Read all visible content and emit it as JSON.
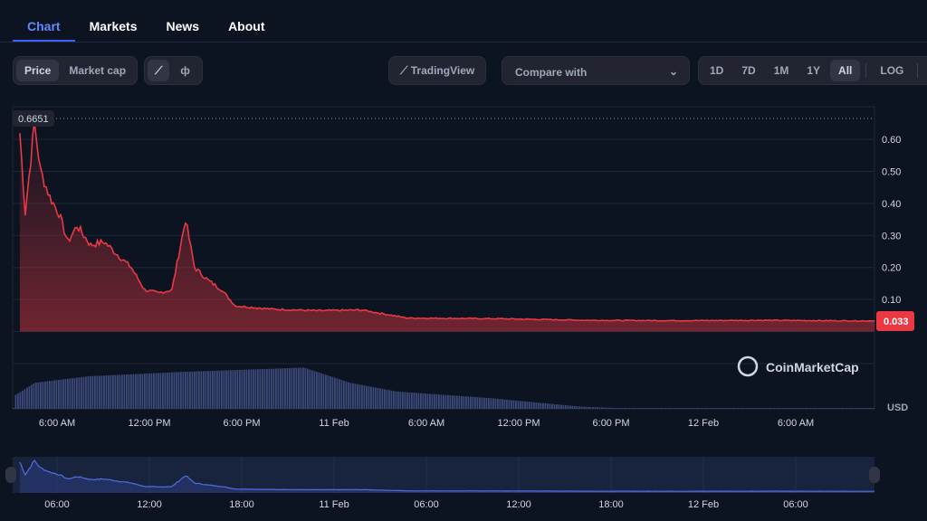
{
  "tabs": [
    {
      "label": "Chart",
      "active": true
    },
    {
      "label": "Markets"
    },
    {
      "label": "News"
    },
    {
      "label": "About"
    }
  ],
  "toolbar": {
    "price": "Price",
    "market_cap": "Market cap",
    "line_icon": "line-chart-icon",
    "candle_icon": "candlestick-icon",
    "tradingview": "TradingView",
    "compare": "Compare with",
    "ranges": [
      "1D",
      "7D",
      "1M",
      "1Y",
      "All"
    ],
    "selected_range": "All",
    "log": "LOG",
    "more": "···"
  },
  "watermark": "CoinMarketCap",
  "colors": {
    "line": "#ea3943",
    "accent": "#3861fb",
    "volume": "#3b4a7a",
    "background": "#0d1421"
  },
  "chart_data": {
    "type": "line",
    "currency_label": "USD",
    "high_label": "0.6651",
    "last_price_label": "0.033",
    "ylim": [
      0,
      0.67
    ],
    "yticks": [
      "0.10",
      "0.20",
      "0.30",
      "0.40",
      "0.50",
      "0.60"
    ],
    "xticks": [
      "6:00 AM",
      "12:00 PM",
      "6:00 PM",
      "11 Feb",
      "6:00 AM",
      "12:00 PM",
      "6:00 PM",
      "12 Feb",
      "6:00 AM"
    ],
    "grid": true,
    "price": [
      [
        "10 Feb 03:35",
        0.62
      ],
      [
        "10 Feb 03:56",
        0.37
      ],
      [
        "10 Feb 04:32",
        0.65
      ],
      [
        "10 Feb 04:56",
        0.5
      ],
      [
        "10 Feb 05:32",
        0.42
      ],
      [
        "10 Feb 06:07",
        0.37
      ],
      [
        "10 Feb 06:42",
        0.28
      ],
      [
        "10 Feb 07:18",
        0.33
      ],
      [
        "10 Feb 08:11",
        0.27
      ],
      [
        "10 Feb 09:04",
        0.28
      ],
      [
        "10 Feb 09:56",
        0.24
      ],
      [
        "10 Feb 10:49",
        0.2
      ],
      [
        "10 Feb 11:42",
        0.13
      ],
      [
        "10 Feb 12:35",
        0.12
      ],
      [
        "10 Feb 13:28",
        0.13
      ],
      [
        "10 Feb 14:21",
        0.35
      ],
      [
        "10 Feb 14:56",
        0.2
      ],
      [
        "10 Feb 15:49",
        0.16
      ],
      [
        "10 Feb 16:42",
        0.13
      ],
      [
        "10 Feb 17:35",
        0.08
      ],
      [
        "10 Feb 19:56",
        0.07
      ],
      [
        "10 Feb 22:53",
        0.065
      ],
      [
        "11 Feb 01:49",
        0.067
      ],
      [
        "11 Feb 04:46",
        0.042
      ],
      [
        "11 Feb 10:38",
        0.04
      ],
      [
        "11 Feb 16:32",
        0.035
      ],
      [
        "11 Feb 22:25",
        0.034
      ],
      [
        "12 Feb 04:00",
        0.035
      ],
      [
        "12 Feb 10:40",
        0.033
      ]
    ],
    "volume_relative": [
      [
        "10 Feb 03:10",
        0.3
      ],
      [
        "10 Feb 04:30",
        0.6
      ],
      [
        "10 Feb 08:00",
        0.75
      ],
      [
        "10 Feb 14:00",
        0.85
      ],
      [
        "10 Feb 18:00",
        0.9
      ],
      [
        "10 Feb 22:00",
        0.95
      ],
      [
        "11 Feb 01:00",
        0.6
      ],
      [
        "11 Feb 04:00",
        0.4
      ],
      [
        "11 Feb 10:00",
        0.25
      ],
      [
        "11 Feb 16:00",
        0.05
      ],
      [
        "11 Feb 20:00",
        0.0
      ],
      [
        "12 Feb 10:40",
        0.0
      ]
    ],
    "navigator_xticks": [
      "06:00",
      "12:00",
      "18:00",
      "11 Feb",
      "06:00",
      "12:00",
      "18:00",
      "12 Feb",
      "06:00"
    ]
  }
}
